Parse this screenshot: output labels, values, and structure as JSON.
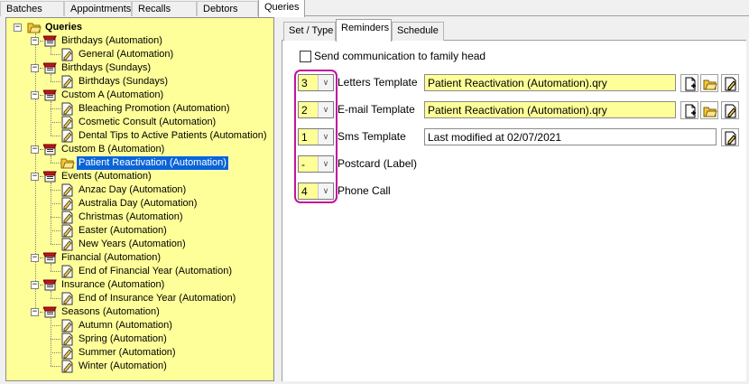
{
  "top_tabs": [
    "Batches",
    "Appointments",
    "Recalls",
    "Debtors",
    "Queries"
  ],
  "tree": {
    "root": "Queries",
    "groups": [
      {
        "label": "Birthdays (Automation)",
        "children": [
          "General (Automation)"
        ]
      },
      {
        "label": "Birthdays (Sundays)",
        "children": [
          "Birthdays (Sundays)"
        ]
      },
      {
        "label": "Custom A (Automation)",
        "children": [
          "Bleaching Promotion (Automation)",
          "Cosmetic Consult (Automation)",
          "Dental Tips to Active Patients (Automation)"
        ]
      },
      {
        "label": "Custom B (Automation)",
        "children": [
          "Patient Reactivation (Automation)"
        ]
      },
      {
        "label": "Events (Automation)",
        "children": [
          "Anzac Day (Automation)",
          "Australia Day (Automation)",
          "Christmas (Automation)",
          "Easter (Automation)",
          "New Years (Automation)"
        ]
      },
      {
        "label": "Financial (Automation)",
        "children": [
          "End of Financial Year (Automation)"
        ]
      },
      {
        "label": "Insurance (Automation)",
        "children": [
          "End of Insurance Year (Automation)"
        ]
      },
      {
        "label": "Seasons (Automation)",
        "children": [
          "Autumn (Automation)",
          "Spring (Automation)",
          "Summer (Automation)",
          "Winter (Automation)"
        ]
      }
    ]
  },
  "sub_tabs": [
    "Set / Type",
    "Reminders",
    "Schedule"
  ],
  "reminders": {
    "family_head_label": "Send communication to family head",
    "rows": [
      {
        "value": "3",
        "label": "Letters Template",
        "field": "Patient Reactivation (Automation).qry"
      },
      {
        "value": "2",
        "label": "E-mail Template",
        "field": "Patient Reactivation (Automation).qry"
      },
      {
        "value": "1",
        "label": "Sms Template",
        "field": "Last modified at 02/07/2021"
      },
      {
        "value": "-",
        "label": "Postcard (Label)"
      },
      {
        "value": "4",
        "label": "Phone Call"
      }
    ]
  },
  "colors": {
    "tree_background": "#ffff99",
    "selection": "#0a64d8",
    "highlight": "#c0149c"
  }
}
